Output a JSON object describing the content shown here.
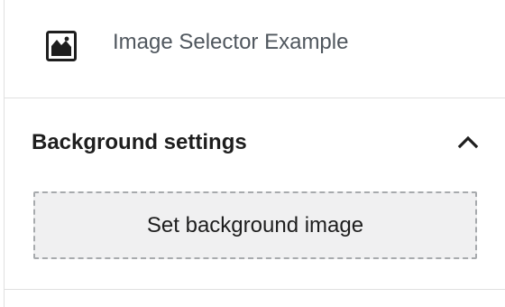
{
  "block_card": {
    "title": "Image Selector Example",
    "icon": "image-block-icon"
  },
  "background_panel": {
    "title": "Background settings",
    "toggle_icon": "chevron-up-icon",
    "expanded": true,
    "set_image_label": "Set background image"
  },
  "colors": {
    "border": "#e0e0e0",
    "title_text": "#1e1e1e",
    "muted_text": "#50575e",
    "button_bg": "#f0f0f1",
    "button_border": "#a7aaad"
  }
}
